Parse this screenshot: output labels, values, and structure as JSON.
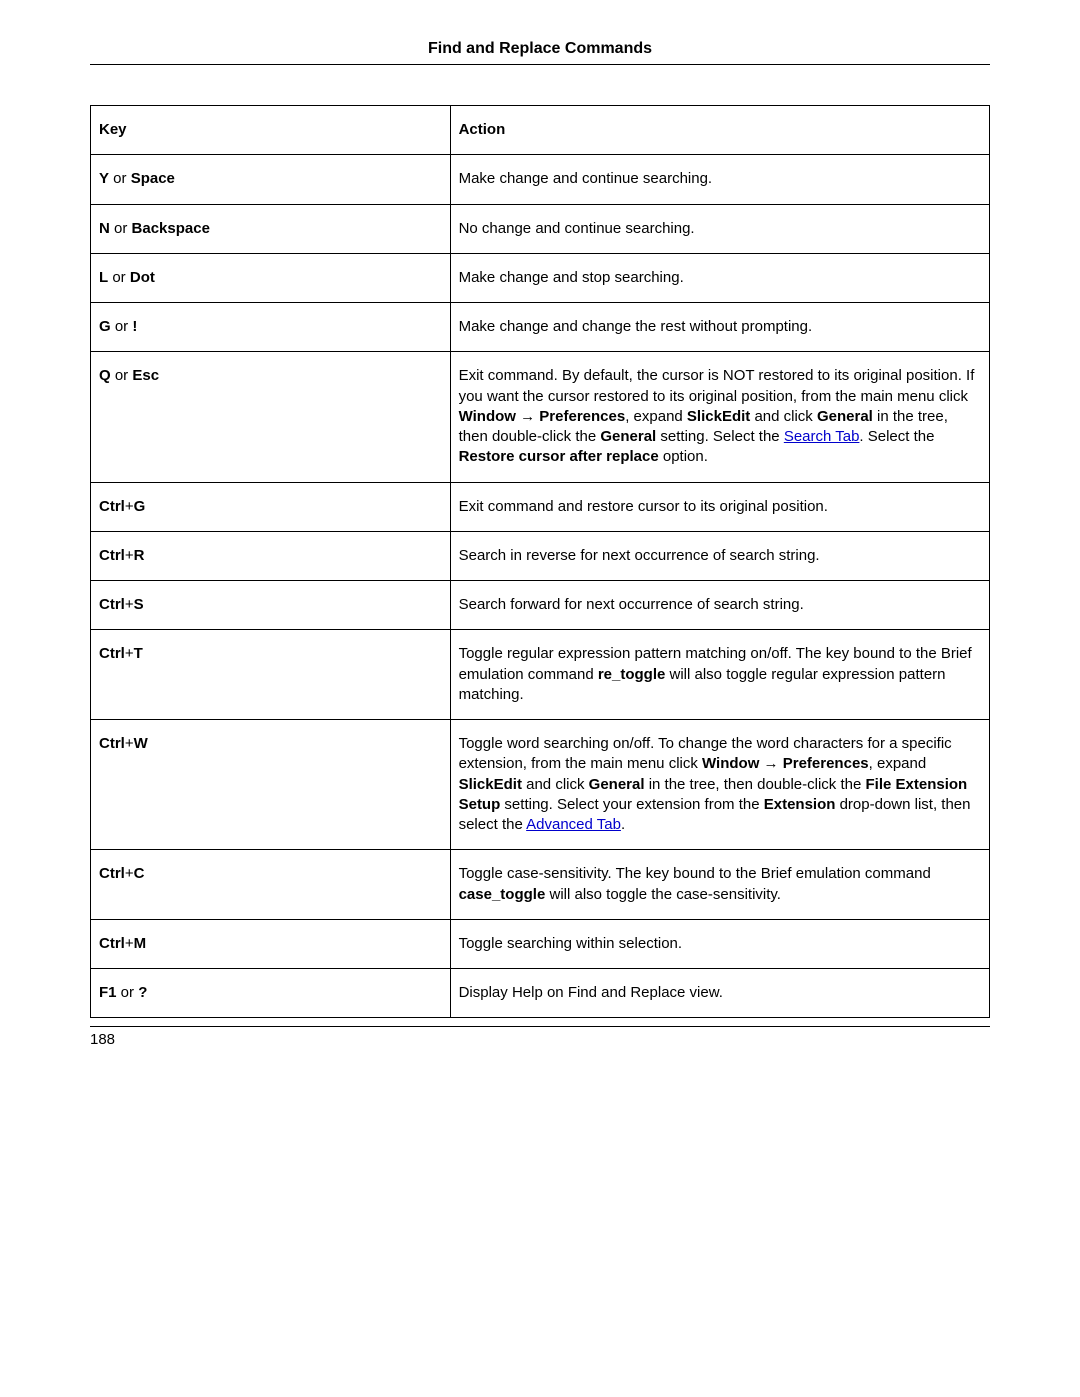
{
  "header": "Find and Replace Commands",
  "page_number": "188",
  "columns": {
    "left": "Key",
    "right": "Action"
  },
  "rows": [
    {
      "keys": [
        "Y",
        "Space"
      ],
      "action_parts": [
        {
          "text": "Make change and continue searching."
        }
      ]
    },
    {
      "keys": [
        "N",
        "Backspace"
      ],
      "action_parts": [
        {
          "text": "No change and continue searching."
        }
      ]
    },
    {
      "keys": [
        "L",
        "Dot"
      ],
      "action_parts": [
        {
          "text": "Make change and stop searching."
        }
      ]
    },
    {
      "keys": [
        "G",
        "!"
      ],
      "action_parts": [
        {
          "text": "Make change and change the rest without prompting."
        }
      ]
    },
    {
      "keys": [
        "Q",
        "Esc"
      ],
      "action_parts": [
        {
          "text": "Exit command. By default, the cursor is NOT restored to its original position. If you want the cursor restored to its original position, from the main menu click "
        },
        {
          "text": "Window",
          "bold": true
        },
        {
          "text": " → "
        },
        {
          "text": "Preferences",
          "bold": true
        },
        {
          "text": ", expand "
        },
        {
          "text": "SlickEdit",
          "bold": true
        },
        {
          "text": " and click "
        },
        {
          "text": "General",
          "bold": true
        },
        {
          "text": " in the tree, then double-click the "
        },
        {
          "text": "General",
          "bold": true
        },
        {
          "text": " setting. Select the "
        },
        {
          "text": "Search Tab",
          "link": true
        },
        {
          "text": ". Select the "
        },
        {
          "text": "Restore cursor after replace",
          "bold": true
        },
        {
          "text": " option."
        }
      ]
    },
    {
      "keys": [
        "Ctrl",
        "G"
      ],
      "combo": true,
      "action_parts": [
        {
          "text": "Exit command and restore cursor to its original position."
        }
      ]
    },
    {
      "keys": [
        "Ctrl",
        "R"
      ],
      "combo": true,
      "action_parts": [
        {
          "text": "Search in reverse for next occurrence of search string."
        }
      ]
    },
    {
      "keys": [
        "Ctrl",
        "S"
      ],
      "combo": true,
      "action_parts": [
        {
          "text": "Search forward for next occurrence of search string."
        }
      ]
    },
    {
      "keys": [
        "Ctrl",
        "T"
      ],
      "combo": true,
      "action_parts": [
        {
          "text": "Toggle regular expression pattern matching on/off. The key bound to the Brief emulation command "
        },
        {
          "text": "re_toggle",
          "bold": true
        },
        {
          "text": " will also toggle regular expression pattern matching."
        }
      ]
    },
    {
      "keys": [
        "Ctrl",
        "W"
      ],
      "combo": true,
      "action_parts": [
        {
          "text": "Toggle word searching on/off. To change the word characters for a specific extension, from the main menu click "
        },
        {
          "text": "Window",
          "bold": true
        },
        {
          "text": " → "
        },
        {
          "text": "Preferences",
          "bold": true
        },
        {
          "text": ", expand "
        },
        {
          "text": "SlickEdit",
          "bold": true
        },
        {
          "text": " and click "
        },
        {
          "text": "General",
          "bold": true
        },
        {
          "text": " in the tree, then double-click the "
        },
        {
          "text": "File Extension Setup",
          "bold": true
        },
        {
          "text": " setting. Select your extension from the "
        },
        {
          "text": "Extension",
          "bold": true
        },
        {
          "text": " drop-down list, then select the "
        },
        {
          "text": "Advanced Tab",
          "link": true
        },
        {
          "text": "."
        }
      ]
    },
    {
      "keys": [
        "Ctrl",
        "C"
      ],
      "combo": true,
      "action_parts": [
        {
          "text": "Toggle case-sensitivity. The key bound to the Brief emulation command "
        },
        {
          "text": "case_toggle",
          "bold": true
        },
        {
          "text": " will also toggle the case-sensitivity."
        }
      ]
    },
    {
      "keys": [
        "Ctrl",
        "M"
      ],
      "combo": true,
      "action_parts": [
        {
          "text": "Toggle searching within selection."
        }
      ]
    },
    {
      "keys": [
        "F1",
        "?"
      ],
      "action_parts": [
        {
          "text": "Display Help on Find and Replace view."
        }
      ]
    }
  ]
}
